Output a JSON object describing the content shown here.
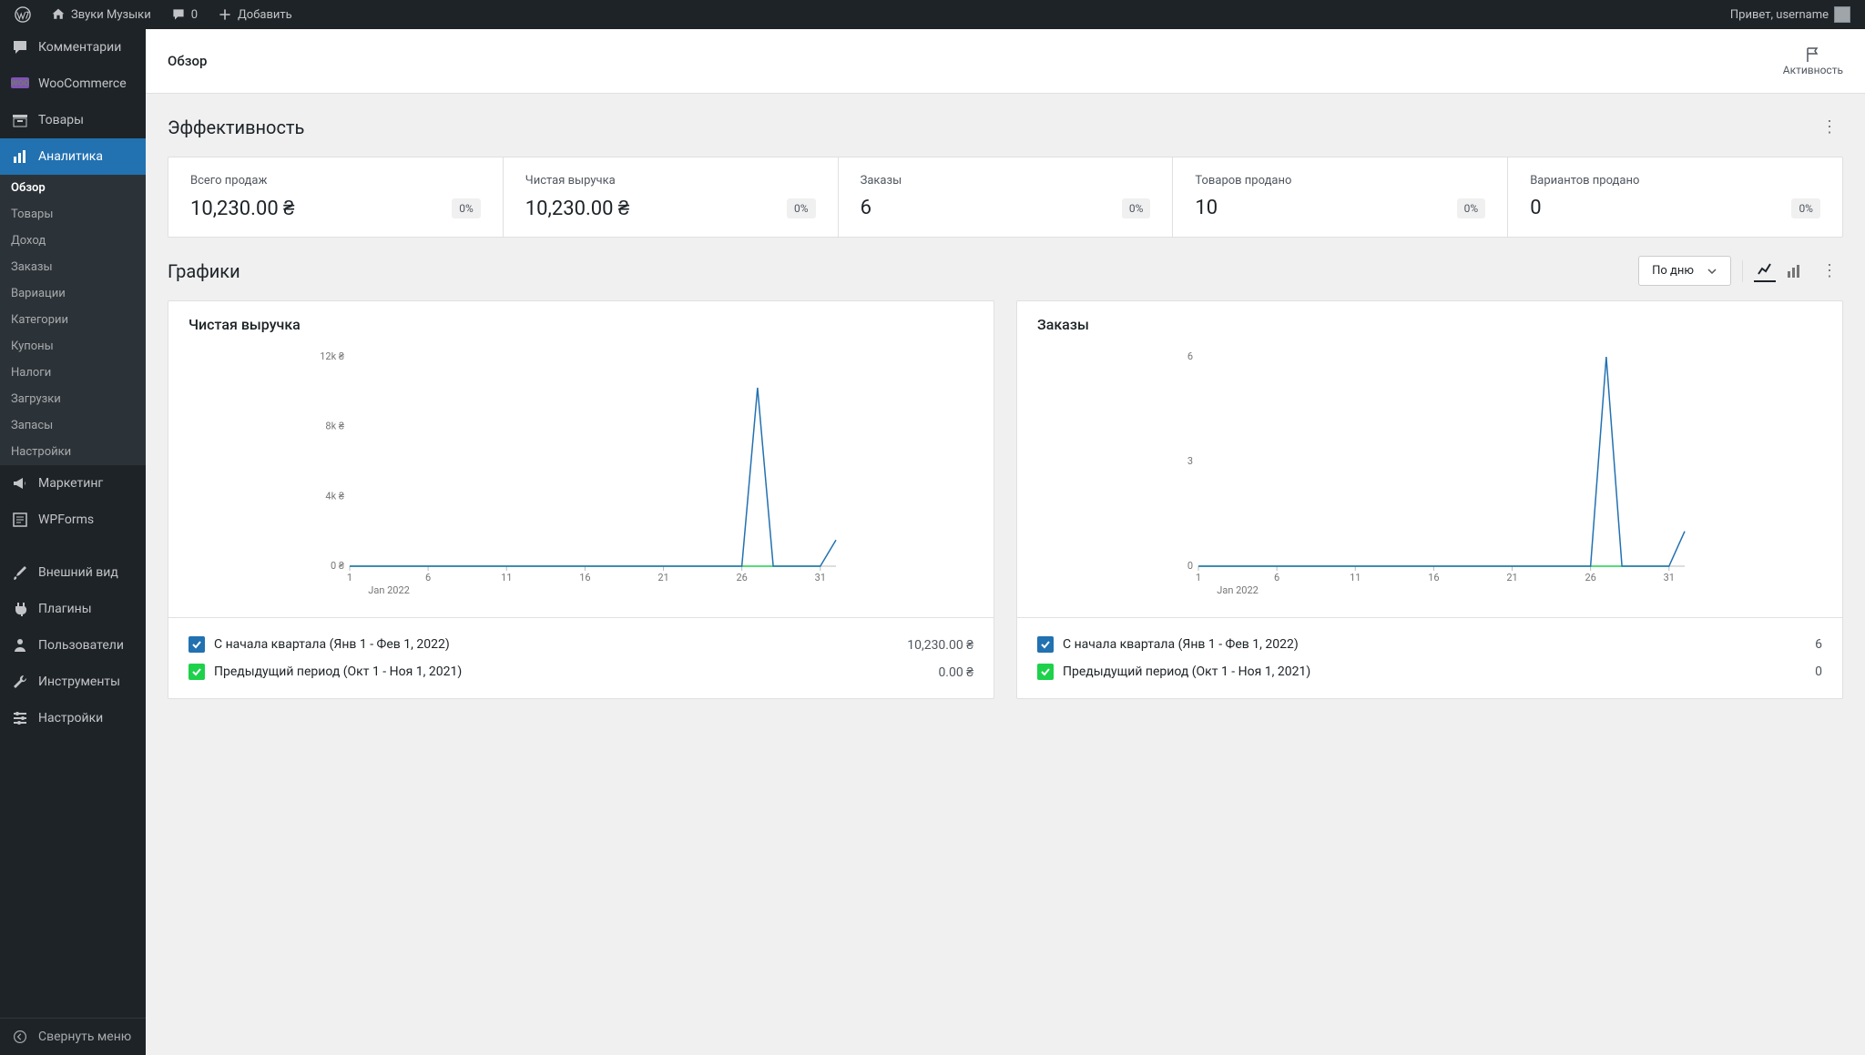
{
  "top": {
    "site_name": "Звуки Музыки",
    "comments": "0",
    "add_new": "Добавить",
    "greeting": "Привет, username"
  },
  "sidebar": {
    "comments": "Комментарии",
    "woocommerce": "WooCommerce",
    "products": "Товары",
    "analytics": "Аналитика",
    "sub": {
      "overview": "Обзор",
      "products": "Товары",
      "revenue": "Доход",
      "orders": "Заказы",
      "variations": "Вариации",
      "categories": "Категории",
      "coupons": "Купоны",
      "taxes": "Налоги",
      "downloads": "Загрузки",
      "stock": "Запасы",
      "settings": "Настройки"
    },
    "marketing": "Маркетинг",
    "wpforms": "WPForms",
    "appearance": "Внешний вид",
    "plugins": "Плагины",
    "users": "Пользователи",
    "tools": "Инструменты",
    "settings": "Настройки",
    "collapse": "Свернуть меню"
  },
  "page": {
    "title": "Обзор",
    "activity": "Активность",
    "performance_title": "Эффективность",
    "charts_title": "Графики",
    "by_day": "По дню"
  },
  "kpi": [
    {
      "label": "Всего продаж",
      "value": "10,230.00 ₴",
      "delta": "0%"
    },
    {
      "label": "Чистая выручка",
      "value": "10,230.00 ₴",
      "delta": "0%"
    },
    {
      "label": "Заказы",
      "value": "6",
      "delta": "0%"
    },
    {
      "label": "Товаров продано",
      "value": "10",
      "delta": "0%"
    },
    {
      "label": "Вариантов продано",
      "value": "0",
      "delta": "0%"
    }
  ],
  "charts": {
    "net_revenue": {
      "title": "Чистая выручка",
      "legend_current": "С начала квартала (Янв 1 - Фев 1, 2022)",
      "legend_previous": "Предыдущий период (Окт 1 - Ноя 1, 2021)",
      "value_current": "10,230.00 ₴",
      "value_previous": "0.00 ₴"
    },
    "orders": {
      "title": "Заказы",
      "legend_current": "С начала квартала (Янв 1 - Фев 1, 2022)",
      "legend_previous": "Предыдущий период (Окт 1 - Ноя 1, 2021)",
      "value_current": "6",
      "value_previous": "0"
    }
  },
  "chart_data": [
    {
      "type": "line",
      "title": "Чистая выручка",
      "xlabel": "Jan 2022",
      "ylabel": "",
      "ylim": [
        0,
        12000
      ],
      "y_ticks": [
        "0 ₴",
        "4k ₴",
        "8k ₴",
        "12k ₴"
      ],
      "x_ticks": [
        "1",
        "6",
        "11",
        "16",
        "21",
        "26",
        "31"
      ],
      "series": [
        {
          "name": "current",
          "color": "#2271b1",
          "x": [
            1,
            6,
            11,
            16,
            21,
            26,
            27,
            28,
            31,
            32
          ],
          "y": [
            0,
            0,
            0,
            0,
            0,
            0,
            10230,
            0,
            0,
            1500
          ]
        },
        {
          "name": "previous",
          "color": "#1ed14b",
          "x": [
            1,
            6,
            11,
            16,
            21,
            26,
            31
          ],
          "y": [
            0,
            0,
            0,
            0,
            0,
            0,
            0
          ]
        }
      ]
    },
    {
      "type": "line",
      "title": "Заказы",
      "xlabel": "Jan 2022",
      "ylabel": "",
      "ylim": [
        0,
        6
      ],
      "y_ticks": [
        "0",
        "3",
        "6"
      ],
      "x_ticks": [
        "1",
        "6",
        "11",
        "16",
        "21",
        "26",
        "31"
      ],
      "series": [
        {
          "name": "current",
          "color": "#2271b1",
          "x": [
            1,
            6,
            11,
            16,
            21,
            26,
            27,
            28,
            31,
            32
          ],
          "y": [
            0,
            0,
            0,
            0,
            0,
            0,
            6,
            0,
            0,
            1
          ]
        },
        {
          "name": "previous",
          "color": "#1ed14b",
          "x": [
            1,
            6,
            11,
            16,
            21,
            26,
            31
          ],
          "y": [
            0,
            0,
            0,
            0,
            0,
            0,
            0
          ]
        }
      ]
    }
  ]
}
